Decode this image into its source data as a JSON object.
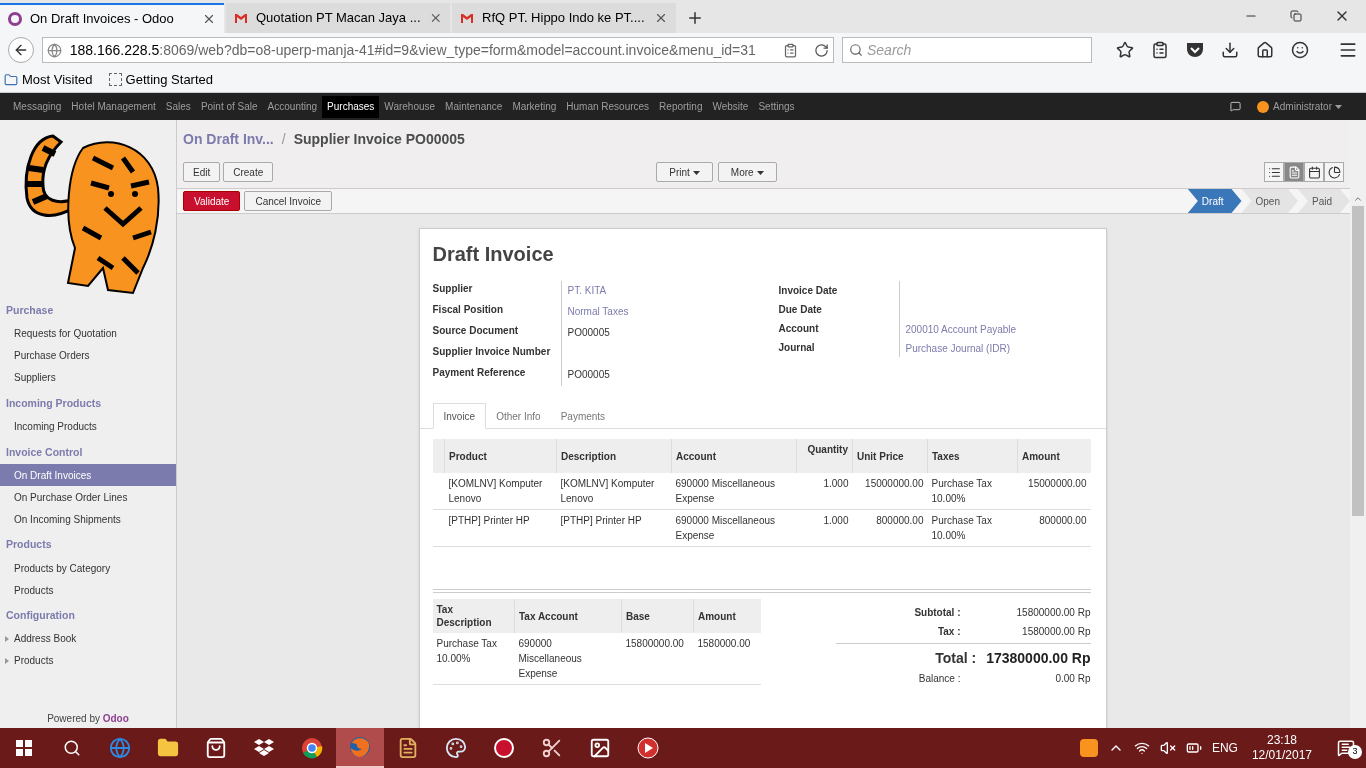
{
  "browser": {
    "tabs": [
      {
        "title": "On Draft Invoices - Odoo",
        "kind": "odoo",
        "selected": true
      },
      {
        "title": "Quotation PT Macan Jaya ...",
        "kind": "mail",
        "selected": false
      },
      {
        "title": "RfQ PT. Hippo Indo ke PT....",
        "kind": "mail",
        "selected": false
      }
    ],
    "url_host": "188.166.228.5",
    "url_rest": ":8069/web?db=o8-uperp-manja-41#id=9&view_type=form&model=account.invoice&menu_id=31",
    "search": {
      "placeholder": "Search"
    },
    "bookmarks": [
      {
        "label": "Most Visited",
        "kind": "folder"
      },
      {
        "label": "Getting Started",
        "kind": "page"
      }
    ]
  },
  "menu": [
    {
      "label": "Messaging",
      "selected": false
    },
    {
      "label": "Hotel Management",
      "selected": false
    },
    {
      "label": "Sales",
      "selected": false
    },
    {
      "label": "Point of Sale",
      "selected": false
    },
    {
      "label": "Accounting",
      "selected": false
    },
    {
      "label": "Purchases",
      "selected": true
    },
    {
      "label": "Warehouse",
      "selected": false
    },
    {
      "label": "Maintenance",
      "selected": false
    },
    {
      "label": "Marketing",
      "selected": false
    },
    {
      "label": "Human Resources",
      "selected": false
    },
    {
      "label": "Reporting",
      "selected": false
    },
    {
      "label": "Website",
      "selected": false
    },
    {
      "label": "Settings",
      "selected": false
    }
  ],
  "user": "Administrator",
  "sidebar": {
    "sections": [
      {
        "title": "Purchase",
        "items": [
          {
            "label": "Requests for Quotation",
            "kind": "link",
            "selected": false
          },
          {
            "label": "Purchase Orders",
            "kind": "link",
            "selected": false
          },
          {
            "label": "Suppliers",
            "kind": "link",
            "selected": false
          }
        ]
      },
      {
        "title": "Incoming Products",
        "items": [
          {
            "label": "Incoming Products",
            "kind": "link",
            "selected": false
          }
        ]
      },
      {
        "title": "Invoice Control",
        "items": [
          {
            "label": "On Draft Invoices",
            "kind": "link",
            "selected": true
          },
          {
            "label": "On Purchase Order Lines",
            "kind": "link",
            "selected": false
          },
          {
            "label": "On Incoming Shipments",
            "kind": "link",
            "selected": false
          }
        ]
      },
      {
        "title": "Products",
        "items": [
          {
            "label": "Products by Category",
            "kind": "link",
            "selected": false
          },
          {
            "label": "Products",
            "kind": "link",
            "selected": false
          }
        ]
      },
      {
        "title": "Configuration",
        "items": [
          {
            "label": "Address Book",
            "kind": "folder",
            "selected": false
          },
          {
            "label": "Products",
            "kind": "folder",
            "selected": false
          }
        ]
      }
    ],
    "powered_by": "Powered by",
    "brand": "Odoo"
  },
  "breadcrumb": {
    "parent": "On Draft Inv...",
    "separator": "/",
    "current": "Supplier Invoice PO00005"
  },
  "toolbar": {
    "left": [
      "Edit",
      "Create"
    ],
    "menus": [
      "Print",
      "More"
    ],
    "views": [
      {
        "kind": "list",
        "selected": false
      },
      {
        "kind": "form",
        "selected": true
      },
      {
        "kind": "calendar",
        "selected": false
      },
      {
        "kind": "graph",
        "selected": false
      }
    ]
  },
  "actions": [
    {
      "label": "Validate",
      "kind": "primary"
    },
    {
      "label": "Cancel Invoice",
      "kind": "default"
    }
  ],
  "statusbar": [
    {
      "label": "Draft",
      "selected": true
    },
    {
      "label": "Open",
      "selected": false
    },
    {
      "label": "Paid",
      "selected": false
    }
  ],
  "sheet": {
    "title": "Draft Invoice",
    "left_fields": [
      {
        "label": "Supplier",
        "value": "PT. KITA",
        "kind": "link"
      },
      {
        "label": "Fiscal Position",
        "value": "Normal Taxes",
        "kind": "link"
      },
      {
        "label": "Source Document",
        "value": "PO00005",
        "kind": "text"
      },
      {
        "label": "Supplier Invoice Number"
      },
      {
        "label": "Payment Reference",
        "value": "PO00005",
        "kind": "text"
      }
    ],
    "right_fields": [
      {
        "label": "Invoice Date"
      },
      {
        "label": "Due Date"
      },
      {
        "label": "Account",
        "value": "200010 Account Payable",
        "kind": "link"
      },
      {
        "label": "Journal",
        "value": "Purchase Journal (IDR)",
        "kind": "link"
      }
    ],
    "tabs": [
      {
        "label": "Invoice",
        "selected": true
      },
      {
        "label": "Other Info",
        "selected": false
      },
      {
        "label": "Payments",
        "selected": false
      }
    ],
    "lines": {
      "columns": [
        "Product",
        "Description",
        "Account",
        "Quantity",
        "Unit Price",
        "Taxes",
        "Amount"
      ],
      "rows": [
        [
          "[KOMLNV] Komputer Lenovo",
          "[KOMLNV] Komputer Lenovo",
          "690000 Miscellaneous Expense",
          "1.000",
          "15000000.00",
          "Purchase Tax 10.00%",
          "15000000.00"
        ],
        [
          "[PTHP] Printer HP",
          "[PTHP] Printer HP",
          "690000 Miscellaneous Expense",
          "1.000",
          "800000.00",
          "Purchase Tax 10.00%",
          "800000.00"
        ]
      ]
    },
    "taxes": {
      "columns": [
        "Tax Description",
        "Tax Account",
        "Base",
        "Amount"
      ],
      "rows": [
        [
          "Purchase Tax 10.00%",
          "690000 Miscellaneous Expense",
          "15800000.00",
          "1580000.00"
        ]
      ]
    },
    "totals": [
      {
        "label": "Subtotal :",
        "value": "15800000.00 Rp",
        "kind": "normal"
      },
      {
        "label": "Tax :",
        "value": "1580000.00 Rp",
        "kind": "normal"
      },
      {
        "label": "Total :",
        "value": "17380000.00 Rp",
        "kind": "grand"
      },
      {
        "label": "Balance :",
        "value": "0.00 Rp",
        "kind": "normal"
      }
    ]
  },
  "taskbar": {
    "apps": [
      {
        "kind": "edge",
        "selected": false
      },
      {
        "kind": "folder",
        "selected": false
      },
      {
        "kind": "store",
        "selected": false
      },
      {
        "kind": "box",
        "selected": false
      },
      {
        "kind": "chrome",
        "selected": false
      },
      {
        "kind": "firefox",
        "selected": true
      },
      {
        "kind": "editor",
        "selected": false
      },
      {
        "kind": "palette",
        "selected": false
      },
      {
        "kind": "record",
        "selected": false
      },
      {
        "kind": "scissors",
        "selected": false
      },
      {
        "kind": "image",
        "selected": false
      },
      {
        "kind": "play",
        "selected": false
      }
    ],
    "language": "ENG",
    "time": "23:18",
    "date": "12/01/2017",
    "notifications": "3"
  }
}
